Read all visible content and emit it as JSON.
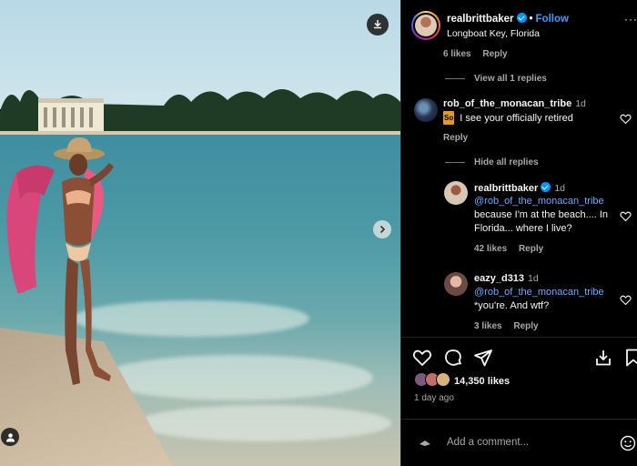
{
  "post": {
    "username": "realbrittbaker",
    "follow_label": "Follow",
    "separator": "•",
    "location": "Longboat Key, Florida",
    "more_label": "···",
    "likes_count": "14,350 likes",
    "posted_ago": "1 day ago",
    "add_comment_placeholder": "Add a comment..."
  },
  "comments": {
    "prev_meta": {
      "likes": "6 likes",
      "reply": "Reply"
    },
    "view_replies_label": "View all 1 replies",
    "main": {
      "username": "rob_of_the_monacan_tribe",
      "time": "1d",
      "emoji_label": "So",
      "text": " I see your officially retired",
      "reply": "Reply"
    },
    "hide_replies_label": "Hide all replies",
    "replies": [
      {
        "username": "realbrittbaker",
        "time": "1d",
        "mention": "@rob_of_the_monacan_tribe",
        "text": "because I'm at the beach.... In Florida... where I live?",
        "likes": "42 likes",
        "reply": "Reply"
      },
      {
        "username": "eazy_d313",
        "time": "1d",
        "mention": "@rob_of_the_monacan_tribe",
        "text": "*you're. And wtf?",
        "likes": "3 likes",
        "reply": "Reply"
      }
    ]
  },
  "icons": {
    "download": "download-icon",
    "next": "chevron-right-icon",
    "user_tag": "user-icon",
    "like": "heart-icon",
    "comment": "comment-icon",
    "share": "send-icon",
    "save": "bookmark-icon",
    "emoji": "smiley-icon"
  },
  "colors": {
    "accent": "#0095f6",
    "follow": "#3b9bff",
    "mention": "#6ea8ff",
    "muted": "#a8a8a8",
    "background": "#000000"
  }
}
